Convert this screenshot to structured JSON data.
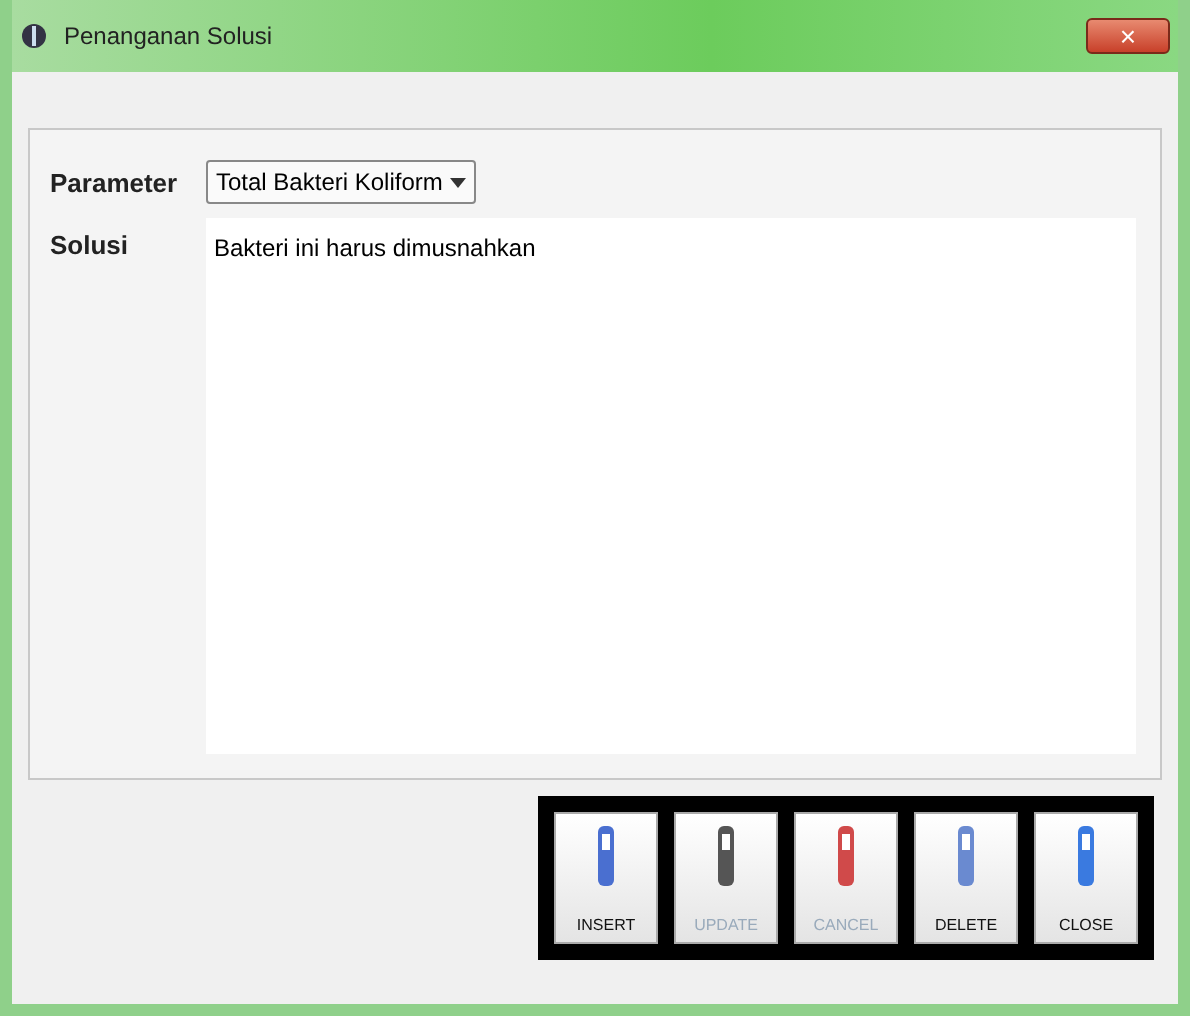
{
  "window": {
    "title": "Penanganan Solusi",
    "close": "×"
  },
  "form": {
    "parameter_label": "Parameter",
    "parameter_value": "Total Bakteri Koliform",
    "solusi_label": "Solusi",
    "solusi_value": "Bakteri ini harus dimusnahkan"
  },
  "buttons": [
    {
      "label": "INSERT",
      "kind": "insert",
      "disabled": false
    },
    {
      "label": "UPDATE",
      "kind": "update",
      "disabled": true
    },
    {
      "label": "CANCEL",
      "kind": "cancel",
      "disabled": true
    },
    {
      "label": "DELETE",
      "kind": "delete",
      "disabled": false
    },
    {
      "label": "CLOSE",
      "kind": "close",
      "disabled": false
    }
  ]
}
